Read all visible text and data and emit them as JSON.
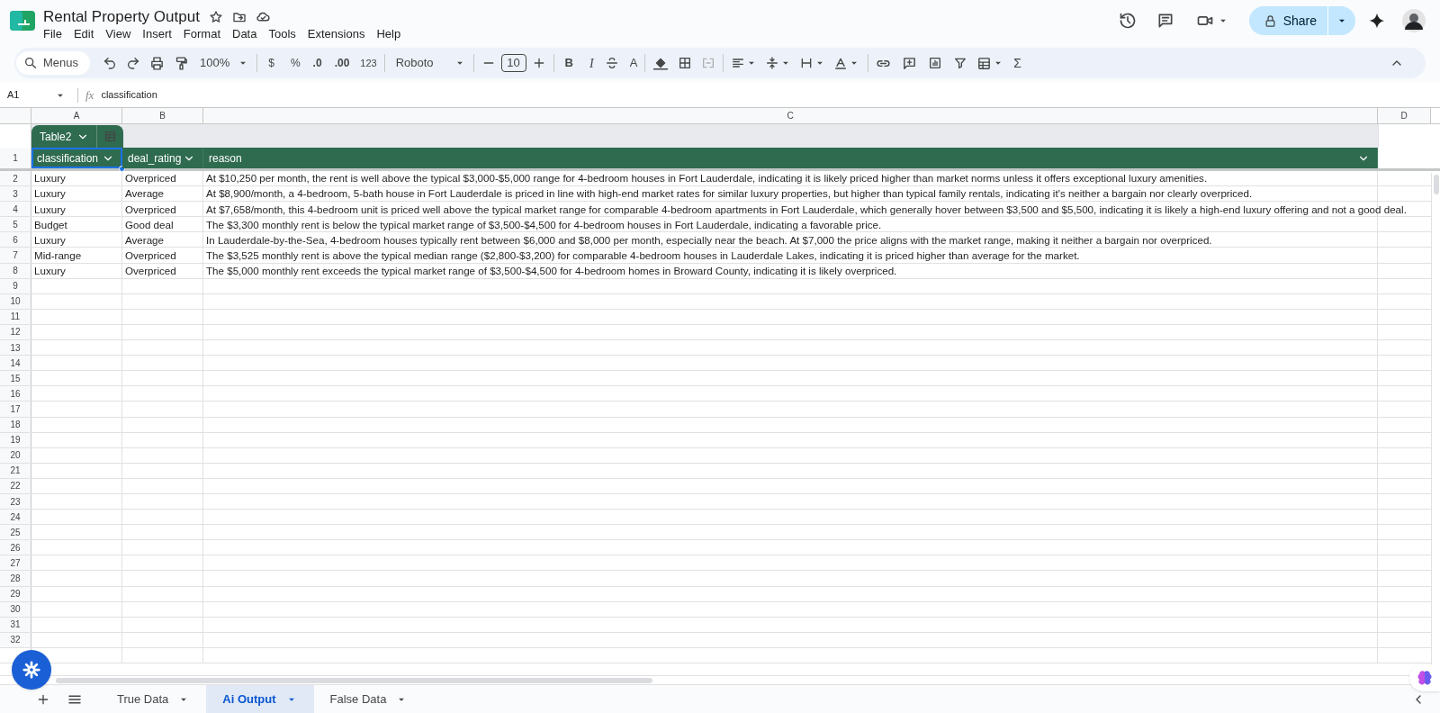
{
  "document": {
    "title": "Rental Property Output"
  },
  "menu": [
    "File",
    "Edit",
    "View",
    "Insert",
    "Format",
    "Data",
    "Tools",
    "Extensions",
    "Help"
  ],
  "share_button": {
    "label": "Share"
  },
  "toolbar": {
    "search": "Menus",
    "zoom": "100%",
    "currency": "$",
    "percent": "%",
    "decrease_decimals": ".0",
    "increase_decimals": ".00",
    "number_format": "123",
    "font": "Roboto",
    "font_size": "10",
    "bold": "B",
    "italic": "I",
    "text_color": "A",
    "functions": "Σ"
  },
  "formula_bar": {
    "name_box": "A1",
    "fx": "fx",
    "value": "classification"
  },
  "column_headers": [
    "A",
    "B",
    "C",
    "D"
  ],
  "table": {
    "name": "Table2",
    "columns": [
      {
        "label": "classification",
        "selected": true
      },
      {
        "label": "deal_rating",
        "selected": false
      },
      {
        "label": "reason",
        "selected": false
      }
    ],
    "rows": [
      [
        "Luxury",
        "Overpriced",
        "At $10,250 per month, the rent is well above the typical $3,000-$5,000 range for 4-bedroom houses in Fort Lauderdale, indicating it is likely priced higher than market norms unless it offers exceptional luxury amenities."
      ],
      [
        "Luxury",
        "Average",
        "At $8,900/month, a 4-bedroom, 5-bath house in Fort Lauderdale is priced in line with high-end market rates for similar luxury properties, but higher than typical family rentals, indicating it's neither a bargain nor clearly overpriced."
      ],
      [
        "Luxury",
        "Overpriced",
        "At $7,658/month, this 4-bedroom unit is priced well above the typical market range for comparable 4-bedroom apartments in Fort Lauderdale, which generally hover between $3,500 and $5,500, indicating it is likely a high-end luxury offering and not a good deal."
      ],
      [
        "Budget",
        "Good deal",
        "The $3,300 monthly rent is below the typical market range of $3,500-$4,500 for 4-bedroom houses in Fort Lauderdale, indicating a favorable price."
      ],
      [
        "Luxury",
        "Average",
        "In Lauderdale-by-the-Sea, 4-bedroom houses typically rent between $6,000 and $8,000 per month, especially near the beach. At $7,000 the price aligns with the market range, making it neither a bargain nor overpriced."
      ],
      [
        "Mid-range",
        "Overpriced",
        "The $3,525 monthly rent is above the typical median range ($2,800-$3,200) for comparable 4-bedroom houses in Lauderdale Lakes, indicating it is priced higher than average for the market."
      ],
      [
        "Luxury",
        "Overpriced",
        "The $5,000 monthly rent exceeds the typical market range of $3,500-$4,500 for 4-bedroom homes in Broward County, indicating it is likely overpriced."
      ]
    ]
  },
  "row_numbers": [
    "1",
    "2",
    "3",
    "4",
    "5",
    "6",
    "7",
    "8",
    "9",
    "10",
    "11",
    "12",
    "13",
    "14",
    "15",
    "16",
    "17",
    "18",
    "19",
    "20",
    "21",
    "22",
    "23",
    "24",
    "25",
    "26",
    "27",
    "28",
    "29",
    "30",
    "31",
    "32"
  ],
  "sheet_tabs": [
    {
      "label": "True Data",
      "selected": false
    },
    {
      "label": "Ai Output",
      "selected": true
    },
    {
      "label": "False Data",
      "selected": false
    }
  ]
}
